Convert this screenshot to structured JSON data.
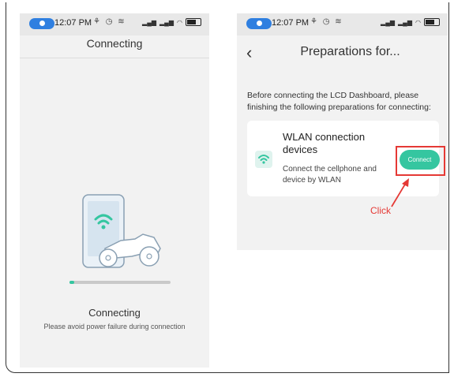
{
  "colors": {
    "accent": "#35c6a0",
    "highlight": "#e53935",
    "location_pill": "#2f7fe0"
  },
  "left_phone": {
    "status_bar": {
      "time": "12:07 PM",
      "glyphs": "⚘ ◷ ≋"
    },
    "title": "Connecting",
    "illustration": "phone-motorcycle-wifi-illustration",
    "progress": 0.05,
    "status_label": "Connecting",
    "status_sub": "Please avoid power failure during connection"
  },
  "right_phone": {
    "status_bar": {
      "time": "12:07 PM",
      "glyphs": "⚘ ◷ ≋"
    },
    "title": "Preparations for...",
    "intro": "Before connecting the LCD Dashboard, please finishing the following preparations for connecting:",
    "card": {
      "icon": "wifi-icon",
      "title": "WLAN connection devices",
      "description": "Connect the cellphone and device by WLAN",
      "button_label": "Connect"
    }
  },
  "annotation": {
    "label": "Click"
  }
}
